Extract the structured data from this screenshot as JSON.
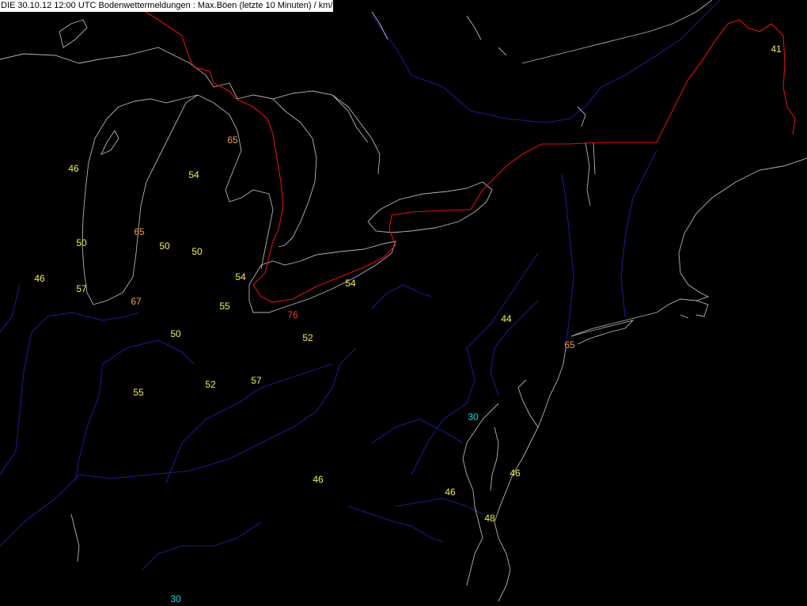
{
  "header": {
    "title": "DIE 30.10.12 12:00 UTC  Bodenwettermeldungen :  Max.Böen (letzte 10 Minuten) / km/h"
  },
  "colors": {
    "background": "#000000",
    "coastline": "#b4b4b4",
    "river": "#1a1a8c",
    "international_border": "#e01010",
    "value_low": "#00e0e0",
    "value_mid": "#f0f050",
    "value_high": "#f0a040",
    "value_extreme": "#ff3030"
  },
  "observations": [
    {
      "value": "41",
      "level": "mid"
    },
    {
      "value": "65",
      "level": "high"
    },
    {
      "value": "46",
      "level": "mid"
    },
    {
      "value": "54",
      "level": "mid"
    },
    {
      "value": "50",
      "level": "mid"
    },
    {
      "value": "65",
      "level": "high"
    },
    {
      "value": "50",
      "level": "mid"
    },
    {
      "value": "50",
      "level": "mid"
    },
    {
      "value": "46",
      "level": "mid"
    },
    {
      "value": "57",
      "level": "mid"
    },
    {
      "value": "54",
      "level": "mid"
    },
    {
      "value": "67",
      "level": "high"
    },
    {
      "value": "55",
      "level": "mid"
    },
    {
      "value": "76",
      "level": "extreme"
    },
    {
      "value": "54",
      "level": "mid"
    },
    {
      "value": "50",
      "level": "mid"
    },
    {
      "value": "52",
      "level": "mid"
    },
    {
      "value": "44",
      "level": "mid"
    },
    {
      "value": "65",
      "level": "high"
    },
    {
      "value": "55",
      "level": "mid"
    },
    {
      "value": "52",
      "level": "mid"
    },
    {
      "value": "57",
      "level": "mid"
    },
    {
      "value": "30",
      "level": "low"
    },
    {
      "value": "46",
      "level": "mid"
    },
    {
      "value": "46",
      "level": "mid"
    },
    {
      "value": "46",
      "level": "mid"
    },
    {
      "value": "48",
      "level": "mid"
    },
    {
      "value": "30",
      "level": "low"
    }
  ]
}
